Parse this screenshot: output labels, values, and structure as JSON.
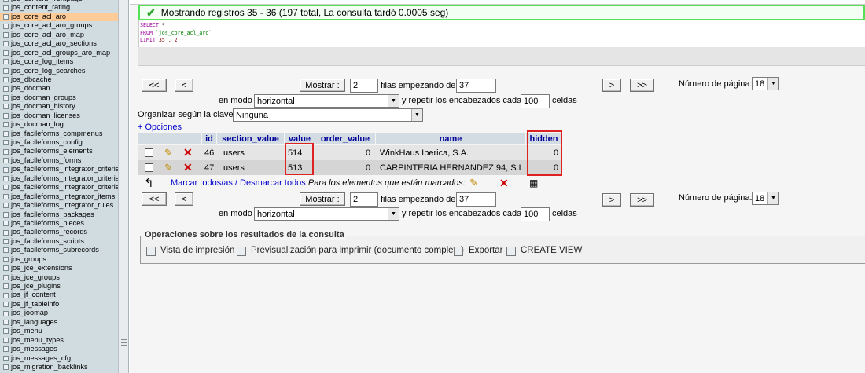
{
  "sidebar": {
    "active_index": 2,
    "tables": [
      "jos_content_frontpage",
      "jos_content_rating",
      "jos_core_acl_aro",
      "jos_core_acl_aro_groups",
      "jos_core_acl_aro_map",
      "jos_core_acl_aro_sections",
      "jos_core_acl_groups_aro_map",
      "jos_core_log_items",
      "jos_core_log_searches",
      "jos_dbcache",
      "jos_docman",
      "jos_docman_groups",
      "jos_docman_history",
      "jos_docman_licenses",
      "jos_docman_log",
      "jos_facileforms_compmenus",
      "jos_facileforms_config",
      "jos_facileforms_elements",
      "jos_facileforms_forms",
      "jos_facileforms_integrator_criteria",
      "jos_facileforms_integrator_criteria",
      "jos_facileforms_integrator_criteria",
      "jos_facileforms_integrator_items",
      "jos_facileforms_integrator_rules",
      "jos_facileforms_packages",
      "jos_facileforms_pieces",
      "jos_facileforms_records",
      "jos_facileforms_scripts",
      "jos_facileforms_subrecords",
      "jos_groups",
      "jos_jce_extensions",
      "jos_jce_groups",
      "jos_jce_plugins",
      "jos_jf_content",
      "jos_jf_tableinfo",
      "jos_joomap",
      "jos_languages",
      "jos_menu",
      "jos_menu_types",
      "jos_messages",
      "jos_messages_cfg",
      "jos_migration_backlinks"
    ]
  },
  "notice": {
    "message": "Mostrando registros 35 - 36 (197 total, La consulta tardó 0.0005 seg)"
  },
  "sql": {
    "select_kw": "SELECT",
    "select_rest": " *",
    "from_kw": "FROM",
    "table": " `jos_core_acl_aro`",
    "limit_kw": "LIMIT",
    "limit_rest": " 35 , 2"
  },
  "nav": {
    "first": "<<",
    "prev": "<",
    "show_button": "Mostrar :",
    "rows_count": "2",
    "rows_label": "filas empezando de",
    "start_row": "37",
    "next": ">",
    "last": ">>",
    "page_label": "Número de página:",
    "page_value": "18",
    "mode_label": "en modo",
    "mode_value": "horizontal",
    "repeat_label": "y repetir los encabezados cada",
    "repeat_value": "100",
    "cells_label": "celdas"
  },
  "sort": {
    "label": "Organizar según la clave:",
    "value": "Ninguna",
    "options_link": "+ Opciones"
  },
  "table": {
    "columns": [
      "id",
      "section_value",
      "value",
      "order_value",
      "name",
      "hidden"
    ],
    "rows": [
      {
        "id": "46",
        "section_value": "users",
        "value": "514",
        "order_value": "0",
        "name": "WinkHaus Iberica, S.A.",
        "hidden": "0"
      },
      {
        "id": "47",
        "section_value": "users",
        "value": "513",
        "order_value": "0",
        "name": "CARPINTERIA HERNANDEZ 94, S.L.",
        "hidden": "0"
      }
    ]
  },
  "bulk": {
    "check_all": "Marcar todos/as",
    "separator": " / ",
    "uncheck_all": "Desmarcar todos",
    "with_selected": "Para los elementos que están marcados:"
  },
  "operations": {
    "legend": "Operaciones sobre los resultados de la consulta",
    "print_view": "Vista de impresión",
    "print_preview": "Previsualización para imprimir (documento completo)",
    "export": "Exportar",
    "create_view": "CREATE VIEW"
  },
  "colors": {
    "header_bg": "#d3dce3",
    "header_text": "#000099",
    "row_odd": "#e5e5e5",
    "row_even": "#d5d5d5",
    "highlight_box": "#dd2222",
    "success_border": "#55e055",
    "active_table": "#ffcc99"
  }
}
